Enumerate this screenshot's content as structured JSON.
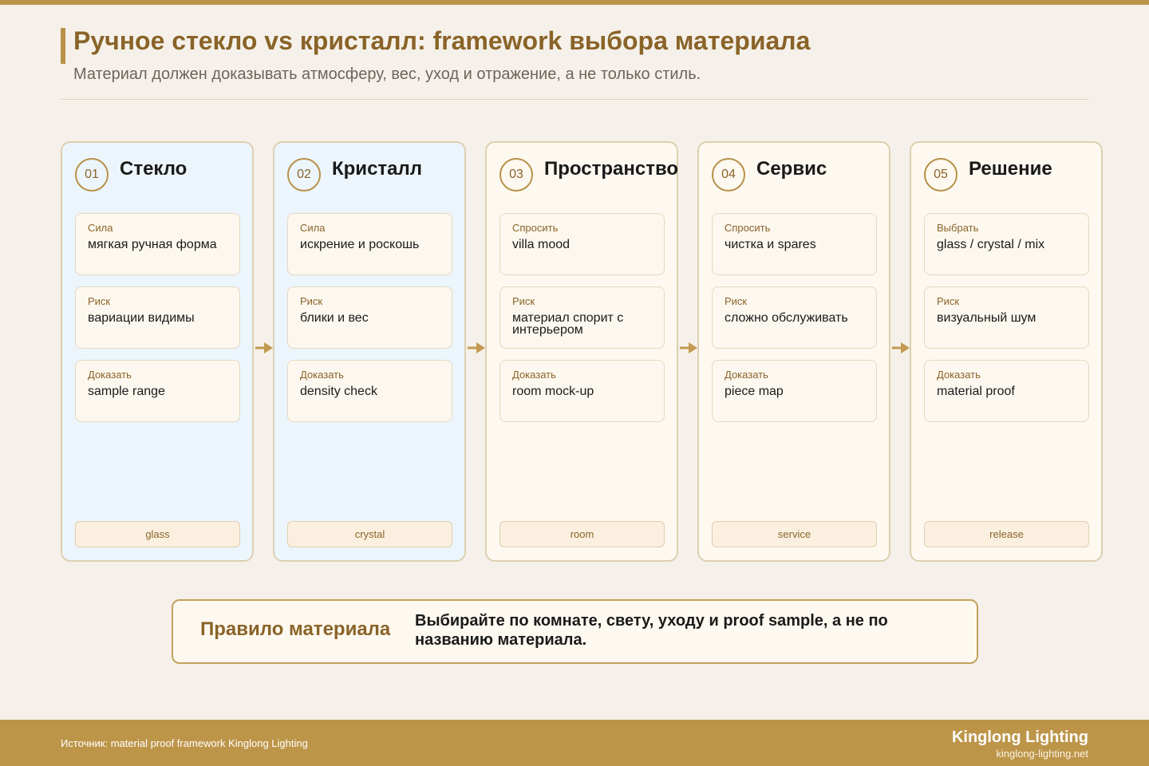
{
  "header": {
    "title": "Ручное стекло vs кристалл: framework выбора материала",
    "subtitle": "Материал должен доказывать атмосферу, вес, уход и отражение, а не только стиль."
  },
  "steps": [
    {
      "number": "01",
      "title": "Стекло",
      "items": [
        {
          "label": "Сила",
          "value": "мягкая ручная форма"
        },
        {
          "label": "Риск",
          "value": "вариации видимы"
        },
        {
          "label": "Доказать",
          "value": "sample range"
        }
      ],
      "tag": "glass"
    },
    {
      "number": "02",
      "title": "Кристалл",
      "items": [
        {
          "label": "Сила",
          "value": "искрение и роскошь"
        },
        {
          "label": "Риск",
          "value": "блики и вес"
        },
        {
          "label": "Доказать",
          "value": "density check"
        }
      ],
      "tag": "crystal"
    },
    {
      "number": "03",
      "title": "Пространство",
      "items": [
        {
          "label": "Спросить",
          "value": "villa mood"
        },
        {
          "label": "Риск",
          "value": "материал спорит с интерьером"
        },
        {
          "label": "Доказать",
          "value": "room mock-up"
        }
      ],
      "tag": "room"
    },
    {
      "number": "04",
      "title": "Сервис",
      "items": [
        {
          "label": "Спросить",
          "value": "чистка и spares"
        },
        {
          "label": "Риск",
          "value": "сложно обслуживать"
        },
        {
          "label": "Доказать",
          "value": "piece map"
        }
      ],
      "tag": "service"
    },
    {
      "number": "05",
      "title": "Решение",
      "items": [
        {
          "label": "Выбрать",
          "value": "glass / crystal / mix"
        },
        {
          "label": "Риск",
          "value": "визуальный шум"
        },
        {
          "label": "Доказать",
          "value": "material proof"
        }
      ],
      "tag": "release"
    }
  ],
  "rule": {
    "title": "Правило материала",
    "text": "Выбирайте по комнате, свету, уходу и proof sample, а не по названию материала."
  },
  "footer": {
    "source": "Источник: material proof framework Kinglong Lighting",
    "brand": "Kinglong Lighting",
    "url": "kinglong-lighting.net"
  },
  "colors": {
    "accent": "#bd9549",
    "title": "#8a6328",
    "card_blue": "#ecf5fb",
    "card_cream": "#fdf9f0"
  }
}
